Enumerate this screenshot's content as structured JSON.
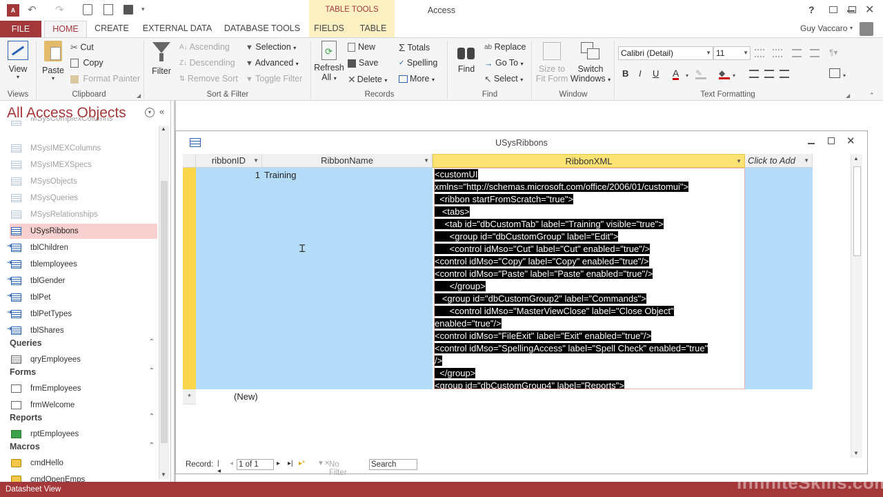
{
  "app": {
    "name": "Access",
    "context_group": "TABLE TOOLS",
    "user": "Guy Vaccaro",
    "help": "?"
  },
  "tabs": [
    "FILE",
    "HOME",
    "CREATE",
    "EXTERNAL DATA",
    "DATABASE TOOLS",
    "FIELDS",
    "TABLE"
  ],
  "ribbon": {
    "views": {
      "view": "View",
      "label": "Views"
    },
    "clipboard": {
      "paste": "Paste",
      "cut": "Cut",
      "copy": "Copy",
      "format_painter": "Format Painter",
      "label": "Clipboard"
    },
    "sort_filter": {
      "filter": "Filter",
      "ascending": "Ascending",
      "descending": "Descending",
      "remove_sort": "Remove Sort",
      "selection": "Selection",
      "advanced": "Advanced",
      "toggle_filter": "Toggle Filter",
      "label": "Sort & Filter"
    },
    "records": {
      "refresh": "Refresh",
      "refresh2": "All",
      "new": "New",
      "save": "Save",
      "delete": "Delete",
      "totals": "Totals",
      "spelling": "Spelling",
      "more": "More",
      "label": "Records"
    },
    "find": {
      "find": "Find",
      "replace": "Replace",
      "goto": "Go To",
      "select": "Select",
      "label": "Find"
    },
    "window": {
      "size_to_fit": "Size to",
      "size_to_fit2": "Fit Form",
      "switch": "Switch",
      "switch2": "Windows",
      "label": "Window"
    },
    "text": {
      "font": "Calibri (Detail)",
      "size": "11",
      "bold": "B",
      "italic": "I",
      "underline": "U",
      "label": "Text Formatting"
    }
  },
  "nav": {
    "title": "All Access Objects",
    "tables": [
      {
        "name": "MSysComplexColumns",
        "kind": "sys"
      },
      {
        "name": "MSysIMEXColumns",
        "kind": "sys"
      },
      {
        "name": "MSysIMEXSpecs",
        "kind": "sys"
      },
      {
        "name": "MSysObjects",
        "kind": "sys"
      },
      {
        "name": "MSysQueries",
        "kind": "sys"
      },
      {
        "name": "MSysRelationships",
        "kind": "sys"
      },
      {
        "name": "USysRibbons",
        "kind": "sel"
      },
      {
        "name": "tblChildren",
        "kind": "link"
      },
      {
        "name": "tblemployees",
        "kind": "link"
      },
      {
        "name": "tblGender",
        "kind": "link"
      },
      {
        "name": "tblPet",
        "kind": "link"
      },
      {
        "name": "tblPetTypes",
        "kind": "link"
      },
      {
        "name": "tblShares",
        "kind": "link"
      }
    ],
    "groups": [
      {
        "header": "Queries",
        "items": [
          "qryEmployees"
        ]
      },
      {
        "header": "Forms",
        "items": [
          "frmEmployees",
          "frmWelcome"
        ]
      },
      {
        "header": "Reports",
        "items": [
          "rptEmployees"
        ]
      },
      {
        "header": "Macros",
        "items": [
          "cmdHello",
          "cmdOpenEmps"
        ]
      }
    ]
  },
  "doc": {
    "title": "USysRibbons",
    "columns": [
      "ribbonID",
      "RibbonName",
      "RibbonXML",
      "Click to Add"
    ],
    "row": {
      "id": "1",
      "name": "Training"
    },
    "new_row": "(New)",
    "xml_lines": [
      "<customUI",
      "xmlns=\"http://schemas.microsoft.com/office/2006/01/customui\">",
      "  <ribbon startFromScratch=\"true\">",
      "   <tabs>",
      "    <tab id=\"dbCustomTab\" label=\"Training\" visible=\"true\">",
      "      <group id=\"dbCustomGroup\" label=\"Edit\">",
      "      <control idMso=\"Cut\" label=\"Cut\" enabled=\"true\"/>",
      "<control idMso=\"Copy\" label=\"Copy\" enabled=\"true\"/>",
      "<control idMso=\"Paste\" label=\"Paste\" enabled=\"true\"/>",
      "      </group>",
      "   <group id=\"dbCustomGroup2\" label=\"Commands\">",
      "      <control idMso=\"MasterViewClose\" label=\"Close Object\"",
      "enabled=\"true\"/>",
      "<control idMso=\"FileExit\" label=\"Exit\" enabled=\"true\"/>",
      "<control idMso=\"SpellingAccess\" label=\"Spell Check\" enabled=\"true\"",
      "/>",
      "  </group>",
      "<group id=\"dbCustomGroup4\" label=\"Reports\">"
    ],
    "record_label": "Record:",
    "record_pos": "1 of 1",
    "no_filter": "No Filter",
    "search": "Search"
  },
  "status": "Datasheet View",
  "watermark": "InfiniteSkills.com"
}
